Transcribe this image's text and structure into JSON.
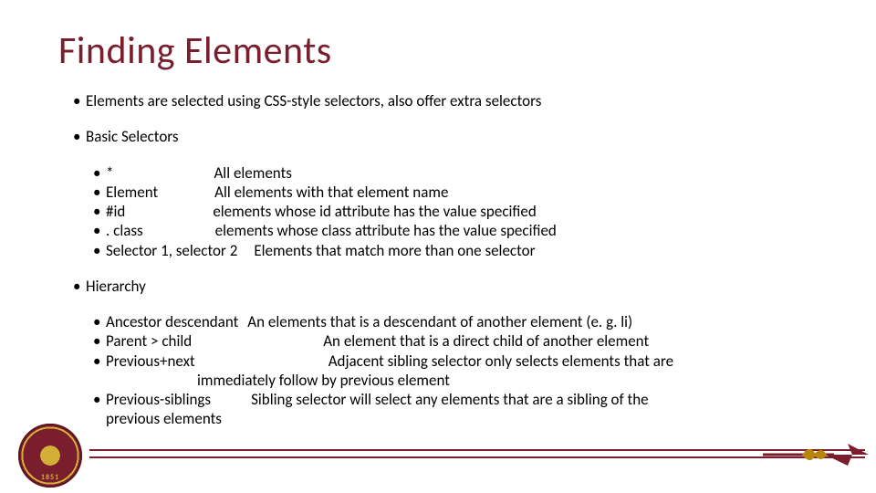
{
  "title": "Finding Elements",
  "p1": "Elements are selected using CSS-style selectors, also offer extra selectors",
  "basic": {
    "heading": "Basic Selectors",
    "items": [
      {
        "sel": "*",
        "gap": 110,
        "desc": "All elements"
      },
      {
        "sel": "Element",
        "gap": 62,
        "desc": "All elements with that element name"
      },
      {
        "sel": "#id",
        "gap": 96,
        "desc": "elements whose id attribute has the value specified"
      },
      {
        "sel": ". class",
        "gap": 79,
        "desc": "elements whose class attribute has the value specified"
      },
      {
        "sel": "Selector 1, selector 2",
        "gap": 18,
        "desc": "Elements that match more than one selector"
      }
    ]
  },
  "hierarchy": {
    "heading": "Hierarchy",
    "items": [
      {
        "sel": "Ancestor descendant",
        "gap": 10,
        "desc": "An elements that is a descendant of another element (e. g. li)"
      },
      {
        "sel": "Parent > child",
        "gap": 144,
        "desc": "An element that is a direct child of another element"
      },
      {
        "sel": "Previous+next",
        "gap": 146,
        "desc": "Adjacent sibling selector only selects elements that are",
        "cont": "immediately follow by previous element",
        "contIndent": 100
      },
      {
        "sel": "Previous-siblings",
        "gap": 44,
        "desc": "Sibling selector will select any elements that are a sibling of the",
        "cont": "previous elements",
        "contIndent": 0
      }
    ]
  },
  "seal_year": "1851"
}
